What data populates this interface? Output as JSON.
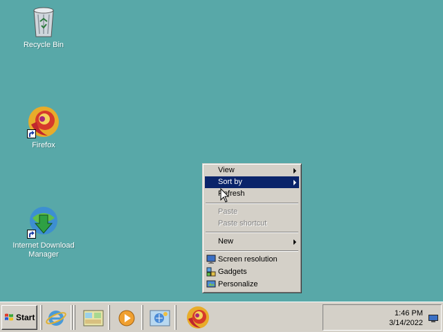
{
  "desktop": {
    "icons": [
      {
        "label": "Recycle Bin",
        "icon": "recycle-bin-icon"
      },
      {
        "label": "Firefox",
        "icon": "firefox-icon"
      },
      {
        "label": "Internet Download Manager",
        "icon": "idm-icon"
      }
    ]
  },
  "context_menu": {
    "items": [
      {
        "label": "View",
        "has_submenu": true
      },
      {
        "label": "Sort by",
        "has_submenu": true,
        "highlighted": true
      },
      {
        "label": "Refresh"
      },
      {
        "label": "Paste",
        "disabled": true
      },
      {
        "label": "Paste shortcut",
        "disabled": true
      },
      {
        "label": "New",
        "has_submenu": true
      },
      {
        "label": "Screen resolution",
        "icon": "screen-resolution-icon"
      },
      {
        "label": "Gadgets",
        "icon": "gadgets-icon"
      },
      {
        "label": "Personalize",
        "icon": "personalize-icon"
      }
    ]
  },
  "taskbar": {
    "start_label": "Start",
    "quick_launch": [
      "internet-explorer-icon",
      "show-desktop-icon",
      "media-player-icon",
      "network-icon",
      "firefox-icon"
    ],
    "clock_time": "1:46 PM",
    "clock_date": "3/14/2022"
  },
  "colors": {
    "desktop": "#58a8a8",
    "menu_highlight": "#0a246a",
    "chrome": "#d4d0c8"
  }
}
